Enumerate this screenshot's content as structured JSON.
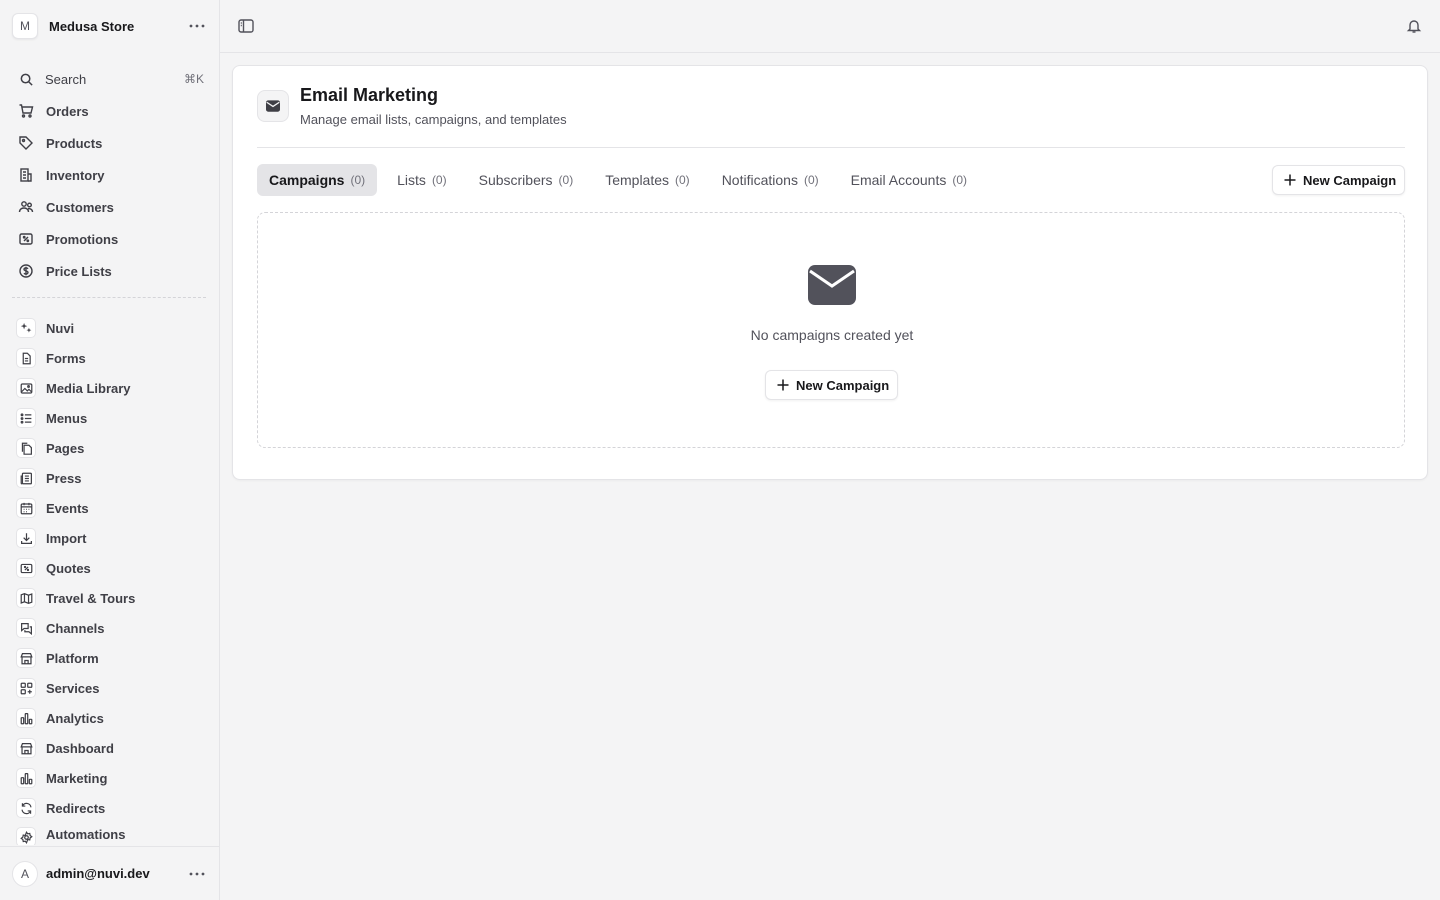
{
  "sidebar": {
    "store": {
      "initial": "M",
      "name": "Medusa Store"
    },
    "search": {
      "label": "Search",
      "shortcut": "⌘K"
    },
    "main_items": [
      {
        "label": "Orders",
        "icon": "cart-icon"
      },
      {
        "label": "Products",
        "icon": "tag-icon"
      },
      {
        "label": "Inventory",
        "icon": "building-icon"
      },
      {
        "label": "Customers",
        "icon": "users-icon"
      },
      {
        "label": "Promotions",
        "icon": "receipt-percent-icon"
      },
      {
        "label": "Price Lists",
        "icon": "currency-dollar-icon"
      }
    ],
    "extension_items": [
      {
        "label": "Nuvi",
        "icon": "sparkles-icon"
      },
      {
        "label": "Forms",
        "icon": "document-text-icon"
      },
      {
        "label": "Media Library",
        "icon": "photo-icon"
      },
      {
        "label": "Menus",
        "icon": "list-bullet-icon"
      },
      {
        "label": "Pages",
        "icon": "documents-icon"
      },
      {
        "label": "Press",
        "icon": "newspaper-icon"
      },
      {
        "label": "Events",
        "icon": "calendar-icon"
      },
      {
        "label": "Import",
        "icon": "arrow-down-tray-icon"
      },
      {
        "label": "Quotes",
        "icon": "receipt-percent-icon"
      },
      {
        "label": "Travel & Tours",
        "icon": "map-icon"
      },
      {
        "label": "Channels",
        "icon": "chat-bubbles-icon"
      },
      {
        "label": "Platform",
        "icon": "buildings-icon"
      },
      {
        "label": "Services",
        "icon": "squares-plus-icon"
      },
      {
        "label": "Analytics",
        "icon": "chart-bar-icon"
      },
      {
        "label": "Dashboard",
        "icon": "buildings-icon"
      },
      {
        "label": "Marketing",
        "icon": "chart-bar-icon"
      },
      {
        "label": "Redirects",
        "icon": "arrow-path-icon"
      },
      {
        "label": "Automations",
        "icon": "cog-icon"
      }
    ],
    "user": {
      "initial": "A",
      "email": "admin@nuvi.dev"
    }
  },
  "page": {
    "title": "Email Marketing",
    "subtitle": "Manage email lists, campaigns, and templates",
    "tabs": [
      {
        "label": "Campaigns",
        "count": "(0)",
        "active": true
      },
      {
        "label": "Lists",
        "count": "(0)"
      },
      {
        "label": "Subscribers",
        "count": "(0)"
      },
      {
        "label": "Templates",
        "count": "(0)"
      },
      {
        "label": "Notifications",
        "count": "(0)"
      },
      {
        "label": "Email Accounts",
        "count": "(0)"
      }
    ],
    "new_campaign_label": "New Campaign",
    "empty_text": "No campaigns created yet",
    "empty_button_label": "New Campaign"
  }
}
